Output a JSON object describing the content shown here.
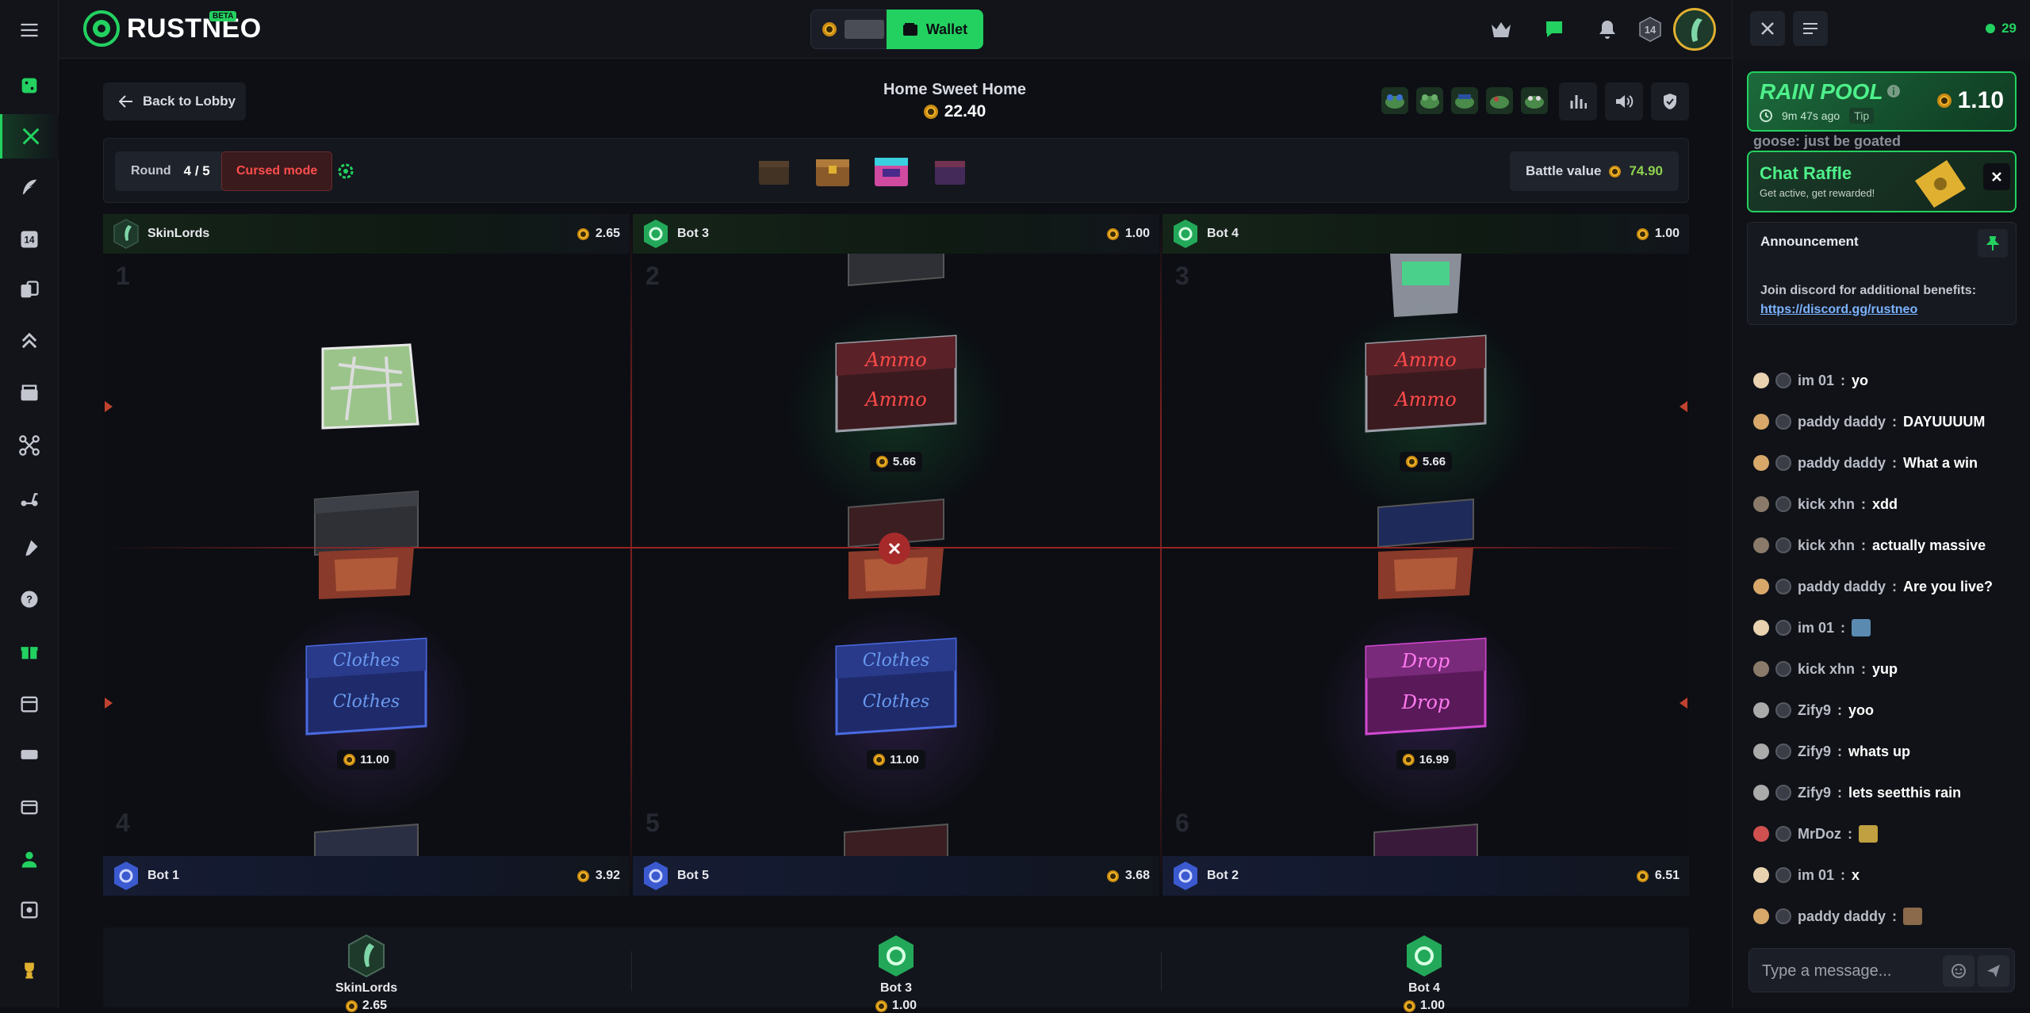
{
  "app": {
    "brand": "RUSTNEO",
    "beta": "BETA",
    "wallet_label": "Wallet",
    "level": "14"
  },
  "battle": {
    "back_label": "Back to Lobby",
    "name": "Home Sweet Home",
    "cost": "22.40",
    "round_label": "Round",
    "round_value": "4 / 5",
    "mode": "Cursed mode",
    "battle_value_label": "Battle value",
    "battle_value": "74.90"
  },
  "columns": [
    {
      "player": "SkinLords",
      "amount": "2.65",
      "slot_top": "1",
      "slot_bottom": "4",
      "bottom_player": "Bot 1",
      "bottom_amount": "3.92",
      "mid_price": "11.00"
    },
    {
      "player": "Bot 3",
      "amount": "1.00",
      "slot_top": "2",
      "slot_bottom": "5",
      "bottom_player": "Bot 5",
      "bottom_amount": "3.68",
      "top_price": "5.66",
      "mid_price": "11.00"
    },
    {
      "player": "Bot 4",
      "amount": "1.00",
      "slot_top": "3",
      "slot_bottom": "6",
      "bottom_player": "Bot 2",
      "bottom_amount": "6.51",
      "top_price": "5.66",
      "mid_price": "16.99"
    }
  ],
  "summary": [
    {
      "name": "SkinLords",
      "amount": "2.65"
    },
    {
      "name": "Bot 3",
      "amount": "1.00"
    },
    {
      "name": "Bot 4",
      "amount": "1.00"
    }
  ],
  "chat": {
    "online": "29",
    "rain": {
      "title": "RAIN POOL",
      "ago": "9m 47s ago",
      "tip": "Tip",
      "value": "1.10"
    },
    "raffle": {
      "title_a": "Chat",
      "title_b": "Raffle",
      "subtitle": "Get active, get rewarded!"
    },
    "announcement": {
      "title": "Announcement",
      "text": "Join discord for additional benefits:",
      "link": "https://discord.gg/rustneo"
    },
    "peek_top": "goose:  just be goated",
    "messages": [
      {
        "user": "im 01",
        "text": "yo"
      },
      {
        "user": "paddy daddy",
        "text": "DAYUUUUM"
      },
      {
        "user": "paddy daddy",
        "text": "What a win"
      },
      {
        "user": "kick xhn",
        "text": "xdd"
      },
      {
        "user": "kick xhn",
        "text": "actually massive"
      },
      {
        "user": "paddy daddy",
        "text": "Are you live?"
      },
      {
        "user": "im 01",
        "text": ""
      },
      {
        "user": "kick xhn",
        "text": "yup"
      },
      {
        "user": "Zify9",
        "text": "yoo"
      },
      {
        "user": "Zify9",
        "text": "whats up"
      },
      {
        "user": "Zify9",
        "text": "lets seetthis rain"
      },
      {
        "user": "MrDoz",
        "text": ""
      },
      {
        "user": "im 01",
        "text": "x"
      },
      {
        "user": "paddy daddy",
        "text": ""
      }
    ],
    "input_placeholder": "Type a message..."
  }
}
